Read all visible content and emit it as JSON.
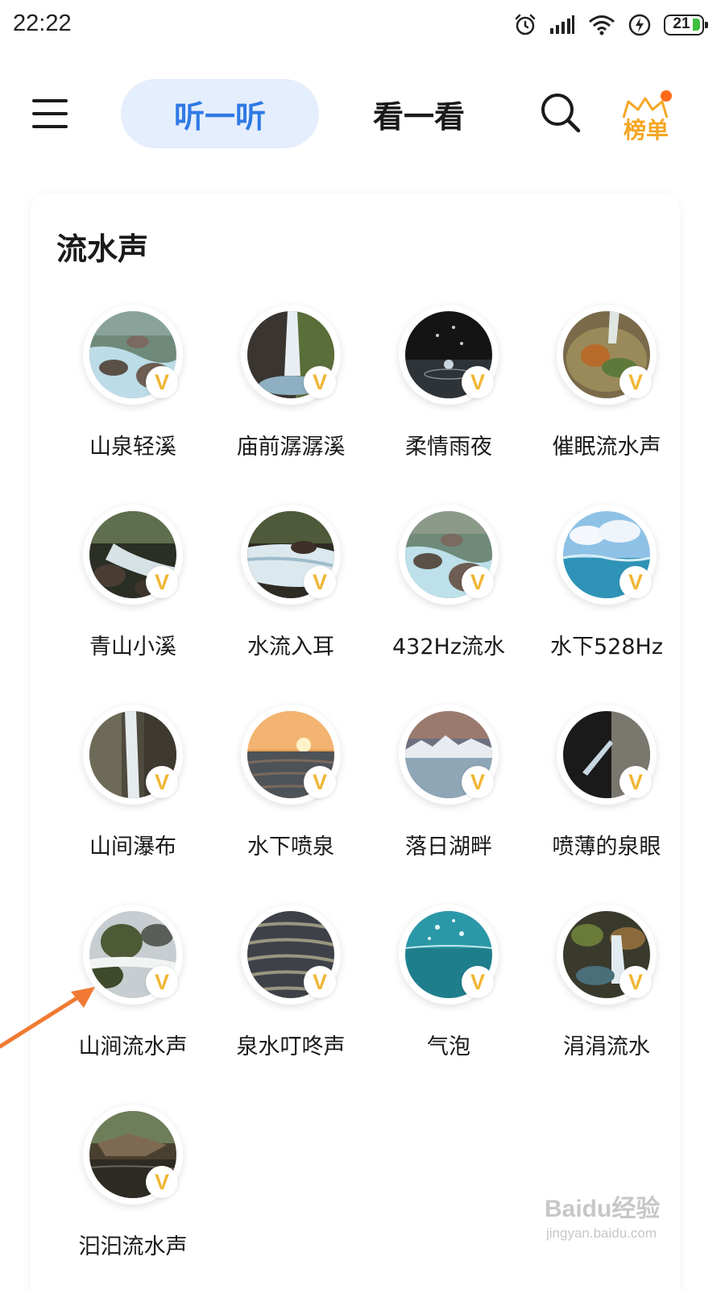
{
  "status_bar": {
    "time": "22:22",
    "battery": "21",
    "icons": [
      "alarm-icon",
      "signal-icon",
      "wifi-icon",
      "charging-icon",
      "battery-icon"
    ]
  },
  "header": {
    "tabs": [
      {
        "label": "听一听",
        "active": true
      },
      {
        "label": "看一看",
        "active": false
      }
    ],
    "rank_label": "榜单"
  },
  "section": {
    "title": "流水声",
    "items": [
      {
        "label": "山泉轻溪",
        "badge": "V"
      },
      {
        "label": "庙前潺潺溪",
        "badge": "V"
      },
      {
        "label": "柔情雨夜",
        "badge": "V"
      },
      {
        "label": "催眠流水声",
        "badge": "V"
      },
      {
        "label": "青山小溪",
        "badge": "V"
      },
      {
        "label": "水流入耳",
        "badge": "V"
      },
      {
        "label": "432Hz流水",
        "badge": "V"
      },
      {
        "label": "水下528Hz",
        "badge": "V"
      },
      {
        "label": "山间瀑布",
        "badge": "V"
      },
      {
        "label": "水下喷泉",
        "badge": "V"
      },
      {
        "label": "落日湖畔",
        "badge": "V"
      },
      {
        "label": "喷薄的泉眼",
        "badge": "V"
      },
      {
        "label": "山涧流水声",
        "badge": "V"
      },
      {
        "label": "泉水叮咚声",
        "badge": "V"
      },
      {
        "label": "气泡",
        "badge": "V"
      },
      {
        "label": "涓涓流水",
        "badge": "V"
      },
      {
        "label": "汩汩流水声",
        "badge": "V"
      }
    ]
  },
  "watermark": {
    "main": "Baidu经验",
    "sub": "jingyan.baidu.com"
  },
  "colors": {
    "accent": "#2f7ae5",
    "tab_bg": "#e5eefc",
    "vip": "#f0b634",
    "rank": "#f5a623",
    "arrow": "#f07a33"
  }
}
